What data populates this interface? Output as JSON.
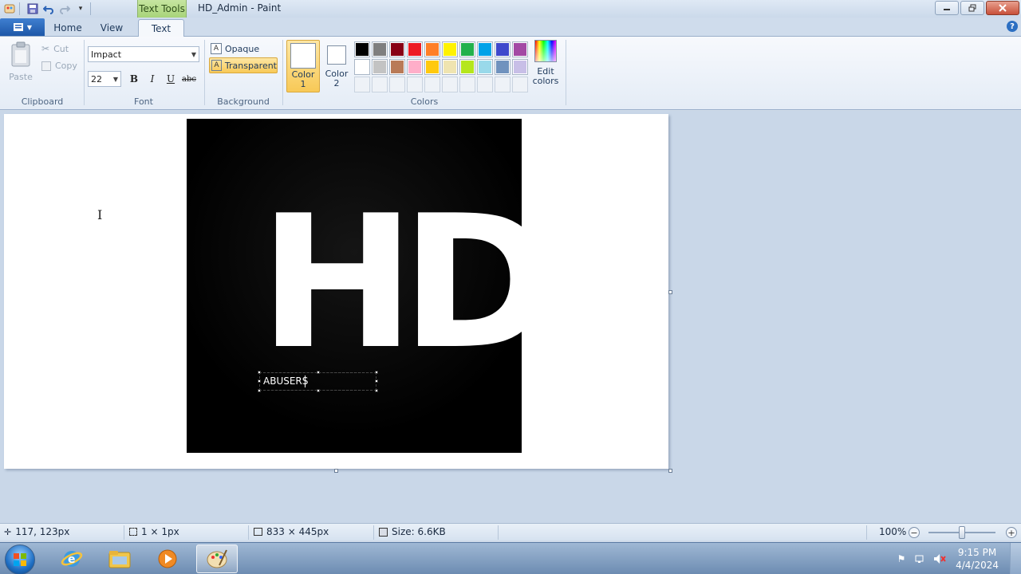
{
  "window": {
    "title": "HD_Admin - Paint",
    "contextual_tab": "Text Tools"
  },
  "tabs": [
    {
      "label": "Home"
    },
    {
      "label": "View"
    },
    {
      "label": "Text"
    }
  ],
  "clipboard": {
    "paste_label": "Paste",
    "cut_label": "Cut",
    "copy_label": "Copy",
    "group_label": "Clipboard"
  },
  "font": {
    "family": "Impact",
    "size": "22",
    "bold_label": "B",
    "italic_label": "I",
    "underline_label": "U",
    "strike_label": "abc",
    "group_label": "Font"
  },
  "background": {
    "opaque_label": "Opaque",
    "transparent_label": "Transparent",
    "group_label": "Background"
  },
  "colors": {
    "color1_label": "Color",
    "color1_num": "1",
    "color2_label": "Color",
    "color2_num": "2",
    "edit_label_1": "Edit",
    "edit_label_2": "colors",
    "group_label": "Colors",
    "color1": "#ffffff",
    "color2": "#ffffff",
    "palette_row1": [
      "#000000",
      "#7f7f7f",
      "#880015",
      "#ed1c24",
      "#ff7f27",
      "#fff200",
      "#22b14c",
      "#00a2e8",
      "#3f48cc",
      "#a349a4"
    ],
    "palette_row2": [
      "#ffffff",
      "#c3c3c3",
      "#b97a57",
      "#ffaec9",
      "#ffc90e",
      "#efe4b0",
      "#b5e61d",
      "#99d9ea",
      "#7092be",
      "#c8bfe7"
    ]
  },
  "canvas": {
    "image_text": "HD",
    "textbox_value": "ABUSERS"
  },
  "status": {
    "cursor_pos": "117, 123px",
    "selection_size": "1 × 1px",
    "image_size": "833 × 445px",
    "file_size": "Size: 6.6KB",
    "zoom": "100%"
  },
  "taskbar": {
    "time": "9:15 PM",
    "date": "4/4/2024"
  }
}
